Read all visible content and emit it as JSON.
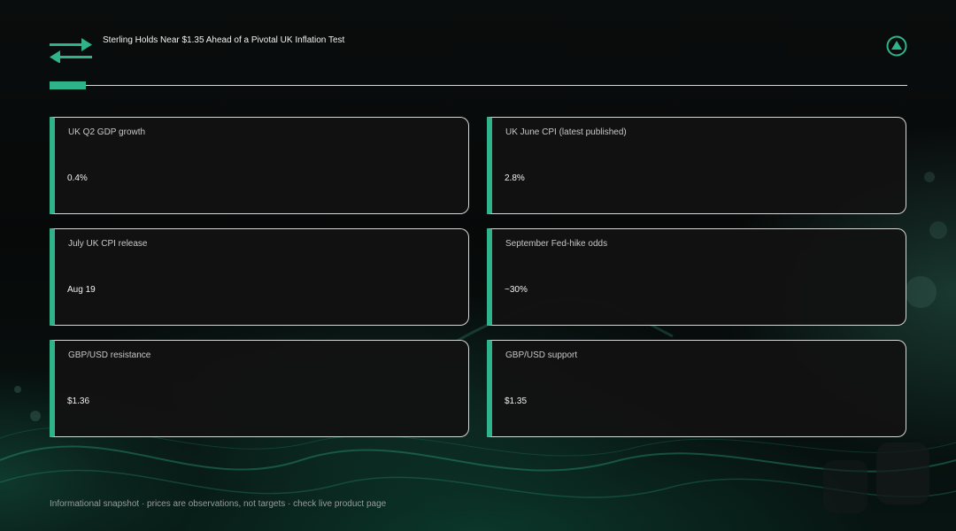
{
  "header": {
    "title": "Sterling Holds Near $1.35 Ahead of a Pivotal UK Inflation Test",
    "logo_icon": "exchange-arrows-icon",
    "alert_icon": "warning-triangle-icon"
  },
  "cards": [
    {
      "label": "UK Q2 GDP growth",
      "value": "0.4%"
    },
    {
      "label": "UK June CPI (latest published)",
      "value": "2.8%"
    },
    {
      "label": "July UK CPI release",
      "value": "Aug 19"
    },
    {
      "label": "September Fed-hike odds",
      "value": "~30%"
    },
    {
      "label": "GBP/USD resistance",
      "value": "$1.36"
    },
    {
      "label": "GBP/USD support",
      "value": "$1.35"
    }
  ],
  "footer": {
    "disclaimer": "Informational snapshot · prices are observations, not targets · check live product page"
  },
  "colors": {
    "accent": "#2fb38a",
    "background": "#050607",
    "card": "#121212",
    "border": "#d8d8d8"
  }
}
